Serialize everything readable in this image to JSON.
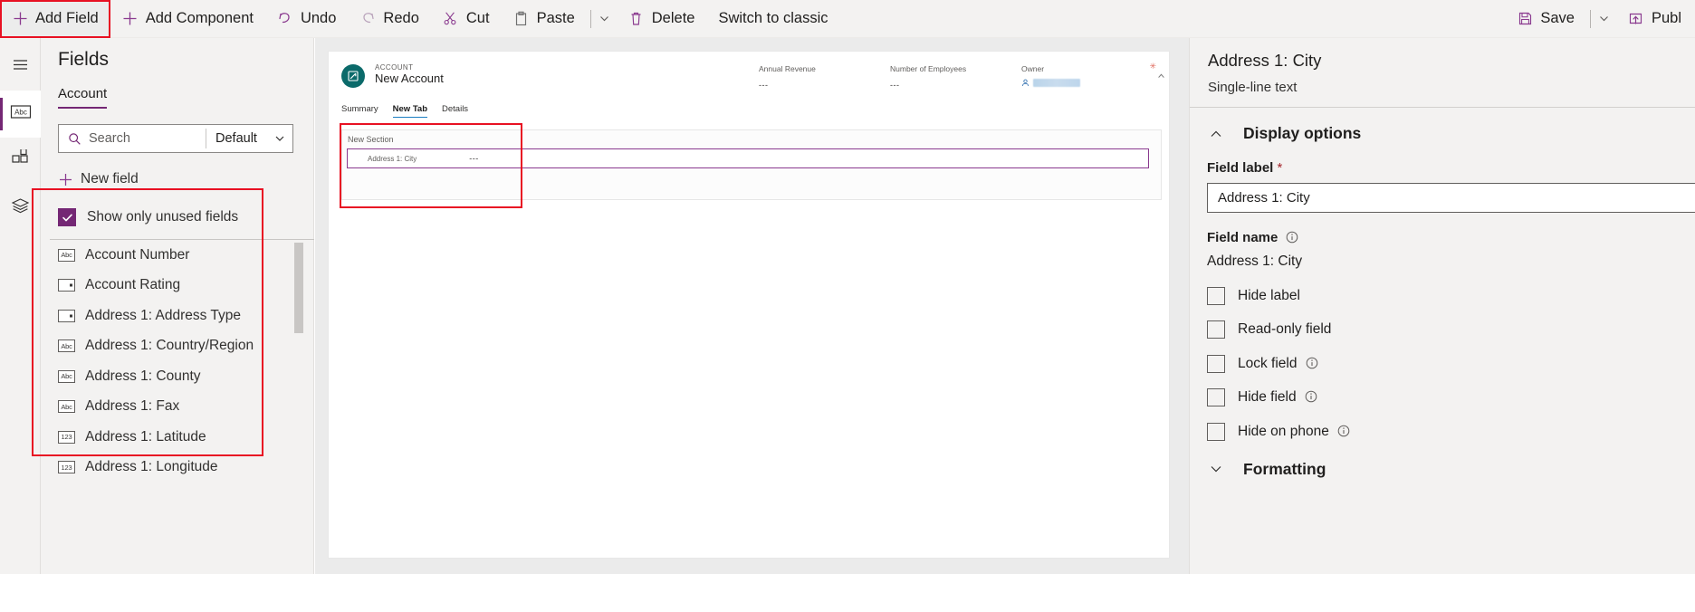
{
  "commandbar": {
    "left_items": [
      {
        "label": "Add Field",
        "icon": "plus-icon",
        "highlighted": true
      },
      {
        "label": "Add Component",
        "icon": "plus-icon",
        "highlighted": false
      },
      {
        "label": "Undo",
        "icon": "undo-icon",
        "highlighted": false
      },
      {
        "label": "Redo",
        "icon": "redo-icon",
        "highlighted": false
      },
      {
        "label": "Cut",
        "icon": "scissors-icon",
        "highlighted": false
      },
      {
        "label": "Paste",
        "icon": "clipboard-icon",
        "highlighted": false
      },
      {
        "label": "Delete",
        "icon": "trash-icon",
        "highlighted": false
      },
      {
        "label": "Switch to classic",
        "icon": "",
        "highlighted": false
      }
    ],
    "right_items": [
      {
        "label": "Save",
        "icon": "save-icon"
      },
      {
        "label": "Publ",
        "icon": "publish-icon"
      }
    ]
  },
  "rail": {
    "items": [
      {
        "name": "menu",
        "icon": "hamburger-icon",
        "active": false
      },
      {
        "name": "fields",
        "icon": "abc-icon",
        "active": true
      },
      {
        "name": "components",
        "icon": "components-grid-icon",
        "active": false
      },
      {
        "name": "tree-view",
        "icon": "layers-icon",
        "active": false
      }
    ]
  },
  "fields_panel": {
    "title": "Fields",
    "tab": "Account",
    "search": {
      "placeholder": "Search",
      "icon": "search-icon"
    },
    "filter": {
      "value": "Default",
      "icon": "chevron-down-icon"
    },
    "new_field": {
      "label": "New field",
      "icon": "plus-icon"
    },
    "show_unused": {
      "label": "Show only unused fields",
      "checked": true
    },
    "close_icon": "close-icon",
    "list": [
      {
        "label": "Account Number",
        "type": "Abc"
      },
      {
        "label": "Account Rating",
        "type": "option"
      },
      {
        "label": "Address 1: Address Type",
        "type": "option"
      },
      {
        "label": "Address 1: Country/Region",
        "type": "Abc"
      },
      {
        "label": "Address 1: County",
        "type": "Abc"
      },
      {
        "label": "Address 1: Fax",
        "type": "Abc"
      },
      {
        "label": "Address 1: Latitude",
        "type": "123"
      },
      {
        "label": "Address 1: Longitude",
        "type": "123"
      }
    ]
  },
  "canvas": {
    "entity_kicker": "ACCOUNT",
    "entity_title": "New Account",
    "entity_icon": "account-icon",
    "header_columns": [
      {
        "label": "Annual Revenue",
        "value": "---"
      },
      {
        "label": "Number of Employees",
        "value": "---"
      },
      {
        "label": "Owner",
        "value": ""
      }
    ],
    "tabs": [
      {
        "label": "Summary",
        "active": false
      },
      {
        "label": "New Tab",
        "active": true
      },
      {
        "label": "Details",
        "active": false
      }
    ],
    "section": {
      "title": "New Section",
      "selected_field": {
        "label": "Address 1: City",
        "value": "---"
      }
    }
  },
  "properties": {
    "title": "Address 1: City",
    "subtitle": "Single-line text",
    "display_options": {
      "label": "Display options",
      "expanded": true,
      "icon": "chevron-up-icon"
    },
    "field_label": {
      "label": "Field label",
      "required": "*",
      "value": "Address 1: City"
    },
    "field_name": {
      "label": "Field name",
      "info_icon": "info-icon",
      "value": "Address 1: City"
    },
    "checkboxes": [
      {
        "label": "Hide label",
        "checked": false,
        "info": false
      },
      {
        "label": "Read-only field",
        "checked": false,
        "info": false
      },
      {
        "label": "Lock field",
        "checked": false,
        "info": true
      },
      {
        "label": "Hide field",
        "checked": false,
        "info": true
      },
      {
        "label": "Hide on phone",
        "checked": false,
        "info": true
      }
    ],
    "formatting": {
      "label": "Formatting",
      "expanded": false,
      "icon": "chevron-down-icon"
    }
  },
  "colors": {
    "accent_purple": "#742774",
    "icon_purple": "#8a3a8f",
    "highlight_red": "#e81123",
    "panel_bg": "#f3f2f1",
    "canvas_bg": "#ebebeb",
    "entity_teal": "#0b6a6a",
    "tab_blue": "#1b7ec2"
  }
}
